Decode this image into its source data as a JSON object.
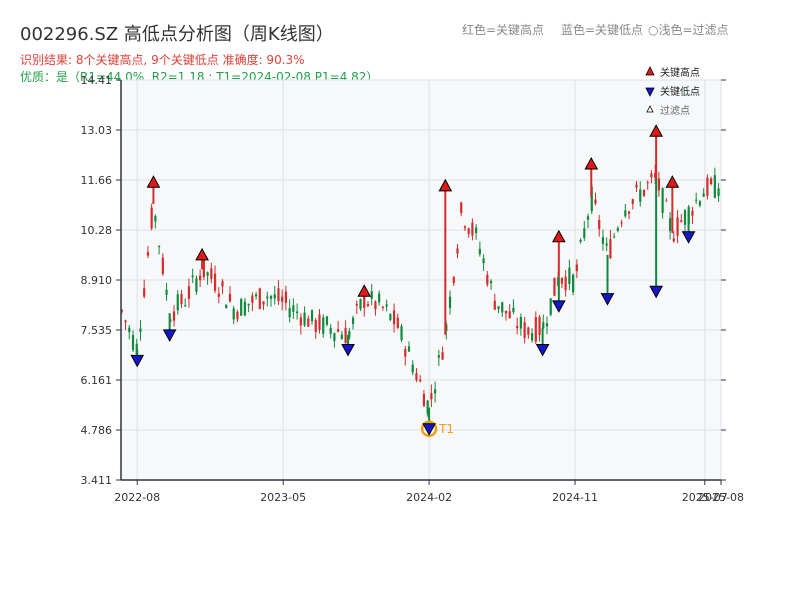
{
  "header": {
    "title": "002296.SZ 高低点分析图（周K线图）",
    "result_line": "识别结果: 8个关键高点, 9个关键低点   准确度: 90.3%",
    "quality_line": "优质：是（R1=44.0%, R2=1.18 ; T1=2024-02-08 P1=4.82）",
    "hint_red": "红色=关键高点",
    "hint_blue": "蓝色=关键低点",
    "hint_white": "浅色=过滤点"
  },
  "chart_data": {
    "type": "candlestick",
    "ylim": [
      3.411,
      14.41
    ],
    "yticks": [
      "3.411",
      "4.786",
      "6.161",
      "7.535",
      "8.910",
      "10.28",
      "11.66",
      "13.03",
      "14.41"
    ],
    "xlim": [
      "2022-07",
      "2025-08"
    ],
    "xticks": [
      {
        "date": "2022-08",
        "label": "2022-08"
      },
      {
        "date": "2023-05",
        "label": "2023-05"
      },
      {
        "date": "2024-02",
        "label": "2024-02"
      },
      {
        "date": "2024-11",
        "label": "2024-11"
      },
      {
        "date": "2025-07",
        "label": "2025-07"
      },
      {
        "date": "2025-08",
        "label": "2025-08"
      }
    ],
    "colors": {
      "up": "#d42b2b",
      "down": "#0f8a3c",
      "high_marker": "#e01818",
      "low_marker": "#1616cc",
      "t1": "#f39c12"
    },
    "legend": {
      "position": "top-right",
      "entries": [
        {
          "marker": "high",
          "label": "关键高点"
        },
        {
          "marker": "low",
          "label": "关键低点"
        },
        {
          "marker": "filtered",
          "label": "过滤点"
        }
      ]
    },
    "key_highs": [
      {
        "date": "2022-09",
        "value": 11.6
      },
      {
        "date": "2022-12",
        "value": 9.6
      },
      {
        "date": "2023-10",
        "value": 8.6
      },
      {
        "date": "2024-03",
        "value": 11.5
      },
      {
        "date": "2024-10",
        "value": 10.1
      },
      {
        "date": "2024-12",
        "value": 12.1
      },
      {
        "date": "2025-04",
        "value": 13.0
      },
      {
        "date": "2025-05",
        "value": 11.6
      }
    ],
    "key_lows": [
      {
        "date": "2022-08",
        "value": 6.7
      },
      {
        "date": "2022-10",
        "value": 7.4
      },
      {
        "date": "2023-09",
        "value": 7.0
      },
      {
        "date": "2024-02",
        "value": 4.82
      },
      {
        "date": "2024-09",
        "value": 7.0
      },
      {
        "date": "2024-10",
        "value": 8.2
      },
      {
        "date": "2025-01",
        "value": 8.4
      },
      {
        "date": "2025-04",
        "value": 8.6
      },
      {
        "date": "2025-06",
        "value": 10.1
      }
    ],
    "t1": {
      "date": "2024-02",
      "value": 4.82,
      "label": "T1"
    },
    "path": [
      [
        "2022-07",
        8.1
      ],
      [
        "2022-08",
        7.0
      ],
      [
        "2022-09",
        11.0
      ],
      [
        "2022-10",
        8.0
      ],
      [
        "2022-11",
        8.4
      ],
      [
        "2022-12",
        9.2
      ],
      [
        "2023-01",
        8.8
      ],
      [
        "2023-02",
        8.1
      ],
      [
        "2023-03",
        8.3
      ],
      [
        "2023-04",
        8.5
      ],
      [
        "2023-05",
        8.3
      ],
      [
        "2023-06",
        8.0
      ],
      [
        "2023-07",
        7.7
      ],
      [
        "2023-08",
        7.6
      ],
      [
        "2023-09",
        7.4
      ],
      [
        "2023-10",
        8.4
      ],
      [
        "2023-11",
        8.2
      ],
      [
        "2023-12",
        7.7
      ],
      [
        "2024-01",
        6.6
      ],
      [
        "2024-02",
        5.4
      ],
      [
        "2024-03",
        7.4
      ],
      [
        "2024-04",
        10.8
      ],
      [
        "2024-05",
        10.0
      ],
      [
        "2024-06",
        8.4
      ],
      [
        "2024-07",
        7.9
      ],
      [
        "2024-08",
        7.5
      ],
      [
        "2024-09",
        7.6
      ],
      [
        "2024-10",
        9.0
      ],
      [
        "2024-11",
        8.9
      ],
      [
        "2024-12",
        11.2
      ],
      [
        "2025-01",
        9.6
      ],
      [
        "2025-02",
        10.9
      ],
      [
        "2025-03",
        11.3
      ],
      [
        "2025-04",
        11.7
      ],
      [
        "2025-05",
        10.2
      ],
      [
        "2025-06",
        10.8
      ],
      [
        "2025-07",
        11.4
      ],
      [
        "2025-08",
        11.5
      ]
    ]
  }
}
